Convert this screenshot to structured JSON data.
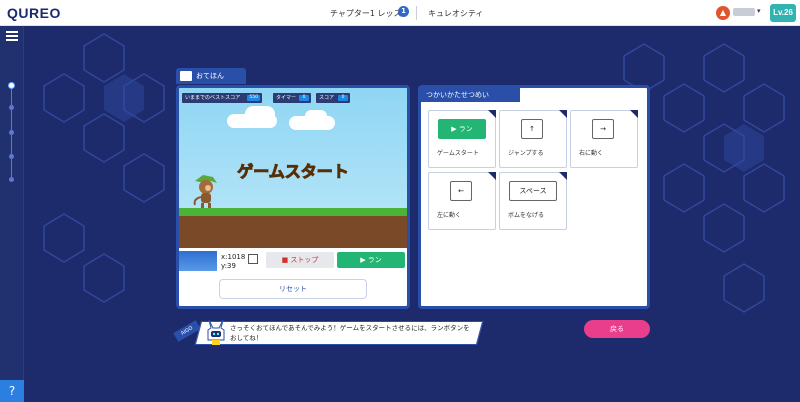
{
  "header": {
    "logo": "QUREO",
    "chapter": "チャプター1 レッスン",
    "lesson_number": "1",
    "course": "キュレオシティ",
    "avatar_letter": "▲",
    "level": "Lv.26"
  },
  "tab": {
    "label": "おてほん"
  },
  "game": {
    "hud": {
      "best_label": "いままでのベストスコア",
      "best_value": "550",
      "timer_label": "タイマー",
      "timer_value": "0",
      "score_label": "スコア",
      "score_value": "0"
    },
    "title": "ゲームスタート"
  },
  "controls": {
    "x": "x:1018",
    "y": "y:39",
    "stop": "■ ストップ",
    "run": "▶ ラン",
    "reset": "リセット"
  },
  "instructions": {
    "title": "つかいかたせつめい",
    "cards": [
      {
        "key": "▶ ラン",
        "desc": "ゲームスタート",
        "icon": "play-icon"
      },
      {
        "key": "↑",
        "desc": "ジャンプする",
        "icon": "up-arrow-icon"
      },
      {
        "key": "→",
        "desc": "右に動く",
        "icon": "right-arrow-icon"
      },
      {
        "key": "←",
        "desc": "左に動く",
        "icon": "left-arrow-icon"
      },
      {
        "key": "スペース",
        "desc": "ボムをなげる",
        "icon": "space-key-icon"
      }
    ]
  },
  "footer": {
    "bot_name": "AIGO",
    "message": "さっそくおてほんであそんでみよう！ゲームをスタートさせるには、ランボタンをおしてね！",
    "back": "戻る"
  },
  "help": "?"
}
